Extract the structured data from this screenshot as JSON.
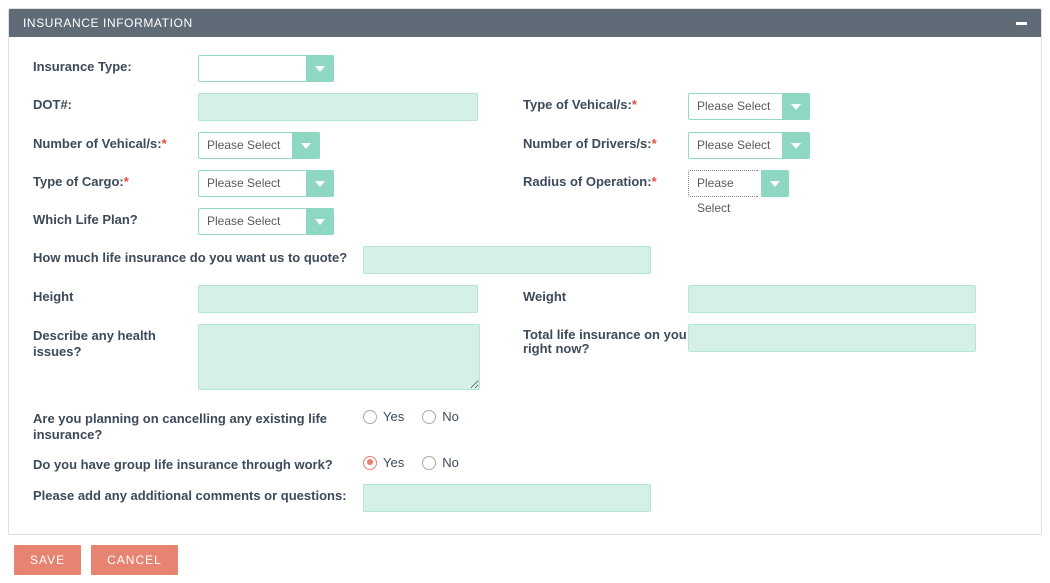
{
  "panel": {
    "title": "INSURANCE INFORMATION"
  },
  "labels": {
    "insurance_type": "Insurance Type:",
    "dot": "DOT#:",
    "vehicle_type": "Type of Vehical/s:",
    "num_vehicles": "Number of Vehical/s:",
    "num_drivers": "Number of Drivers/s:",
    "cargo_type": "Type of Cargo:",
    "radius": "Radius of Operation:",
    "life_plan": "Which Life Plan?",
    "quote_amount": "How much life insurance do you want us to quote?",
    "height": "Height",
    "weight": "Weight",
    "health": "Describe any health issues?",
    "total_life": "Total life insurance on you right now?",
    "cancel_existing": "Are you planning on cancelling any existing life insurance?",
    "group_life": "Do you have group life insurance through work?",
    "comments": "Please add any additional comments or questions:"
  },
  "placeholders": {
    "please_select": "Please Select"
  },
  "options": {
    "yes": "Yes",
    "no": "No"
  },
  "values": {
    "insurance_type": "",
    "dot": "",
    "vehicle_type": "Please Select",
    "num_vehicles": "Please Select",
    "num_drivers": "Please Select",
    "cargo_type": "Please Select",
    "radius": "Please Select",
    "life_plan": "Please Select",
    "quote_amount": "",
    "height": "",
    "weight": "",
    "health": "",
    "total_life": "",
    "cancel_existing": null,
    "group_life": "yes",
    "comments": ""
  },
  "buttons": {
    "save": "SAVE",
    "cancel": "CANCEL"
  }
}
